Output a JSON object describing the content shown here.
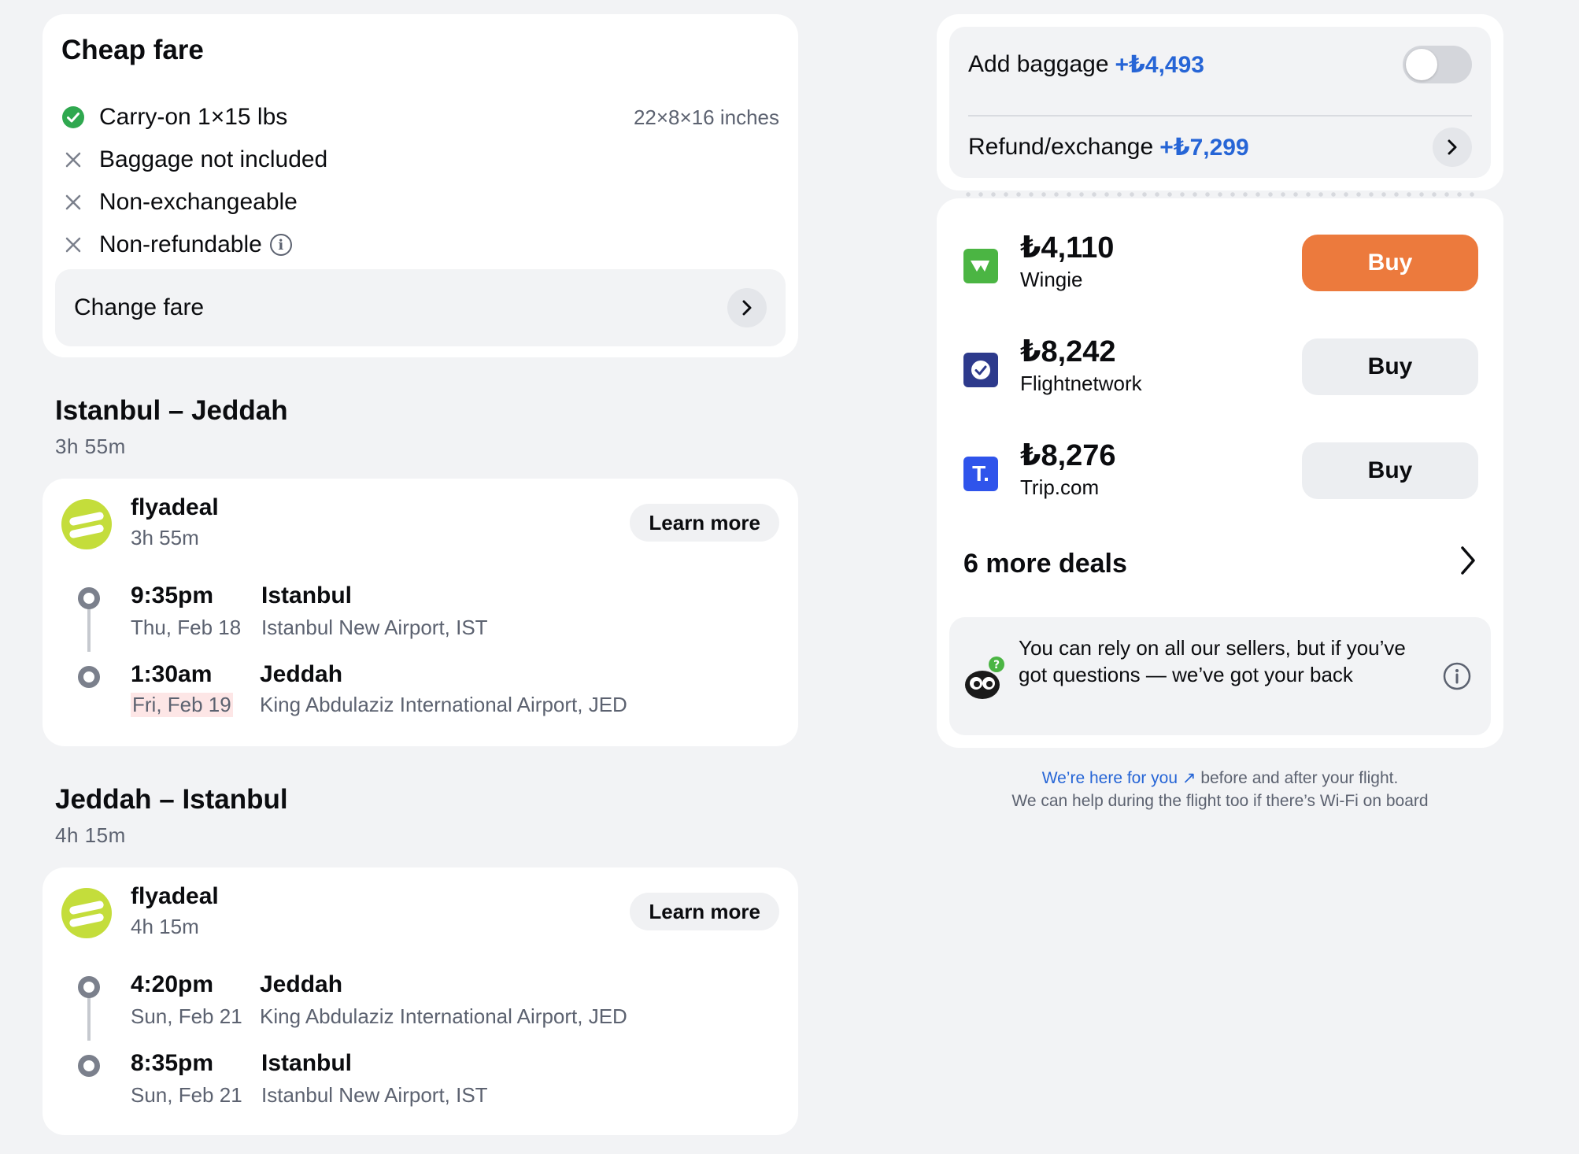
{
  "fare": {
    "title": "Cheap fare",
    "items": [
      {
        "text": "Carry-on 1×15 lbs",
        "side": "22×8×16 inches",
        "status": "included"
      },
      {
        "text": "Baggage not included",
        "status": "excluded"
      },
      {
        "text": "Non-exchangeable",
        "status": "excluded"
      },
      {
        "text": "Non-refundable",
        "status": "excluded"
      }
    ],
    "change_label": "Change fare"
  },
  "routes": [
    {
      "title": "Istanbul – Jeddah",
      "duration": "3h 55m",
      "airline": "flyadeal",
      "airline_duration": "3h 55m",
      "learn_more": "Learn more",
      "depart": {
        "time": "9:35pm",
        "date": "Thu, Feb 18",
        "city": "Istanbul",
        "airport": "Istanbul New Airport, IST"
      },
      "arrive": {
        "time": "1:30am",
        "date": "Fri, Feb 19",
        "city": "Jeddah",
        "airport": "King Abdulaziz International Airport, JED"
      }
    },
    {
      "title": "Jeddah – Istanbul",
      "duration": "4h 15m",
      "airline": "flyadeal",
      "airline_duration": "4h 15m",
      "learn_more": "Learn more",
      "depart": {
        "time": "4:20pm",
        "date": "Sun, Feb 21",
        "city": "Jeddah",
        "airport": "King Abdulaziz International Airport, JED"
      },
      "arrive": {
        "time": "8:35pm",
        "date": "Sun, Feb 21",
        "city": "Istanbul",
        "airport": "Istanbul New Airport, IST"
      }
    }
  ],
  "extras": {
    "baggage_label": "Add baggage",
    "baggage_price": "+₺4,493",
    "baggage_enabled": false,
    "refund_label": "Refund/exchange",
    "refund_price": "+₺7,299"
  },
  "offers": [
    {
      "price": "₺4,110",
      "seller": "Wingie",
      "buy": "Buy",
      "logo_color": "#4bb543",
      "logo_glyph": "W"
    },
    {
      "price": "₺8,242",
      "seller": "Flightnetwork",
      "buy": "Buy",
      "logo_color": "#2d3a8c",
      "logo_glyph": "✓"
    },
    {
      "price": "₺8,276",
      "seller": "Trip.com",
      "buy": "Buy",
      "logo_color": "#2f54eb",
      "logo_glyph": "T."
    }
  ],
  "more_deals": "6 more deals",
  "trust": {
    "text": "You can rely on all our sellers, but if you’ve got questions — we’ve got your back"
  },
  "help": {
    "link": "We’re here for you ↗",
    "line1_rest": " before and after your flight.",
    "line2": "We can help during the flight too if there’s Wi-Fi on board"
  },
  "colors": {
    "accent": "#2665d6",
    "buy_primary": "#ec7a3d",
    "included": "#2fa84f",
    "flyadeal": "#c4dd3b"
  }
}
